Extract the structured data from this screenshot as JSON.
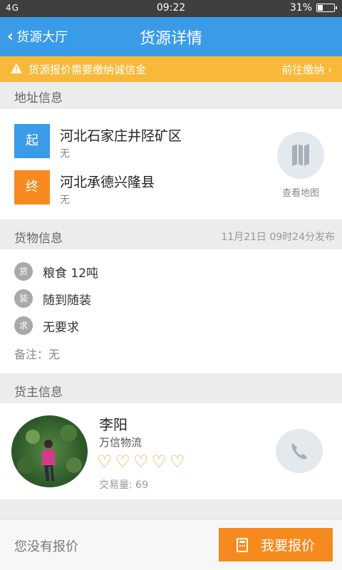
{
  "status_bar": {
    "signal": "4G",
    "time": "09:22",
    "battery": "31%",
    "battery_level": 0.31
  },
  "nav": {
    "back_label": "货源大厅",
    "title": "货源详情"
  },
  "notice": {
    "message": "货源报价需要缴纳诚信金",
    "action": "前往缴纳"
  },
  "address": {
    "header": "地址信息",
    "origin": {
      "tag": "起",
      "place": "河北石家庄井陉矿区",
      "detail": "无",
      "color": "#3a9be8"
    },
    "destination": {
      "tag": "终",
      "place": "河北承德兴隆县",
      "detail": "无",
      "color": "#f78a1f"
    },
    "map_label": "查看地图"
  },
  "goods": {
    "header": "货物信息",
    "published": "11月21日 09时24分发布",
    "rows": [
      {
        "badge": "货",
        "text": "粮食  12吨"
      },
      {
        "badge": "装",
        "text": "随到随装"
      },
      {
        "badge": "求",
        "text": "无要求"
      }
    ],
    "remark": "备注：无"
  },
  "owner": {
    "header": "货主信息",
    "name": "李阳",
    "company": "万信物流",
    "rating": 5,
    "deals": "交易量: 69"
  },
  "bottom": {
    "no_price": "您没有报价",
    "quote_button": "我要报价"
  },
  "colors": {
    "primary": "#3a9be8",
    "accent": "#f78a1f",
    "notice": "#f8b93a"
  }
}
